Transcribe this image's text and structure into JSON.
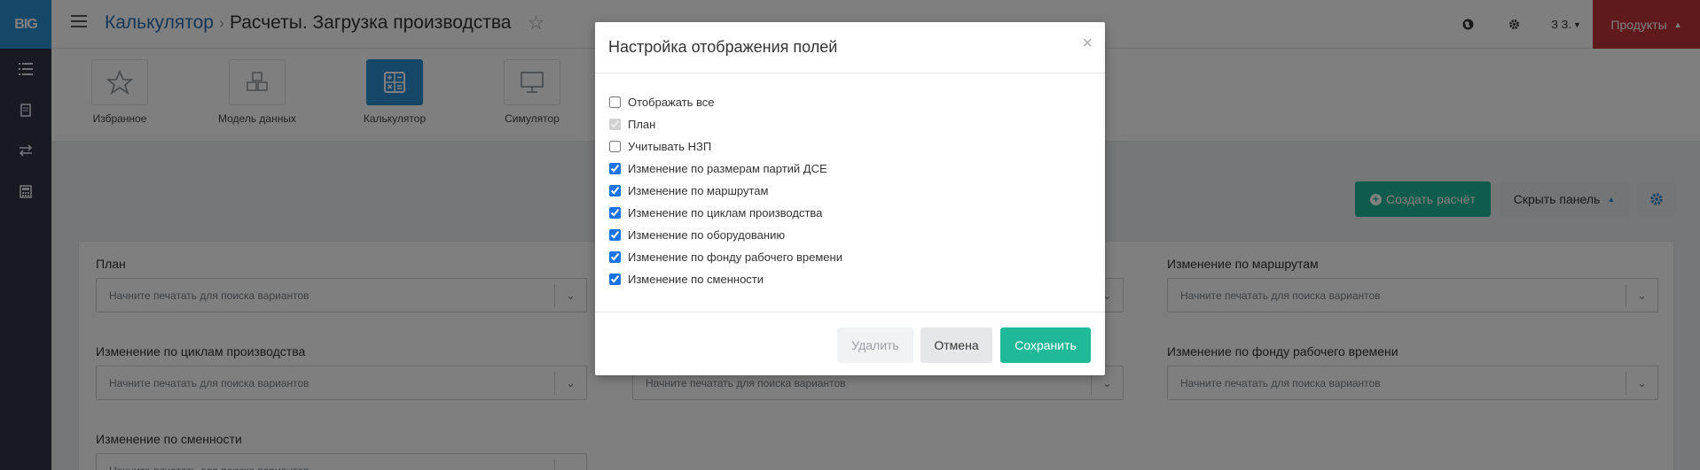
{
  "app": {
    "logo_text": "BIG"
  },
  "sidebar": {
    "items": [
      {
        "icon": "list-icon"
      },
      {
        "icon": "document-icon"
      },
      {
        "icon": "swap-arrows-icon"
      },
      {
        "icon": "calculator-icon"
      }
    ]
  },
  "header": {
    "breadcrumb_parent": "Калькулятор",
    "breadcrumb_current": "Расчеты. Загрузка производства",
    "user_label": "З З.",
    "products_label": "Продукты"
  },
  "modules": [
    {
      "label": "Избранное",
      "icon": "star-icon"
    },
    {
      "label": "Модель данных",
      "icon": "cubes-icon"
    },
    {
      "label": "Калькулятор",
      "icon": "calculator-icon",
      "active": true
    },
    {
      "label": "Симулятор",
      "icon": "monitor-icon"
    }
  ],
  "toolbar": {
    "create_label": "Создать расчёт",
    "hide_panel_label": "Скрыть панель"
  },
  "filters": {
    "placeholder": "Начните печатать для поиска вариантов",
    "fields": [
      {
        "label": "План"
      },
      {
        "label": "Изменение по маршрутам"
      },
      {
        "label": "Изменение по циклам производства"
      },
      {
        "label": "Изменение по фонду рабочего времени"
      },
      {
        "label": "Изменение по сменности"
      }
    ]
  },
  "modal": {
    "title": "Настройка отображения полей",
    "close_symbol": "×",
    "options": [
      {
        "label": "Отображать все",
        "checked": false,
        "disabled": false
      },
      {
        "label": "План",
        "checked": true,
        "disabled": true
      },
      {
        "label": "Учитывать НЗП",
        "checked": false,
        "disabled": false
      },
      {
        "label": "Изменение по размерам партий ДСЕ",
        "checked": true,
        "disabled": false
      },
      {
        "label": "Изменение по маршрутам",
        "checked": true,
        "disabled": false
      },
      {
        "label": "Изменение по циклам производства",
        "checked": true,
        "disabled": false
      },
      {
        "label": "Изменение по оборудованию",
        "checked": true,
        "disabled": false
      },
      {
        "label": "Изменение по фонду рабочего времени",
        "checked": true,
        "disabled": false
      },
      {
        "label": "Изменение по сменности",
        "checked": true,
        "disabled": false
      }
    ],
    "delete_label": "Удалить",
    "cancel_label": "Отмена",
    "save_label": "Сохранить"
  }
}
